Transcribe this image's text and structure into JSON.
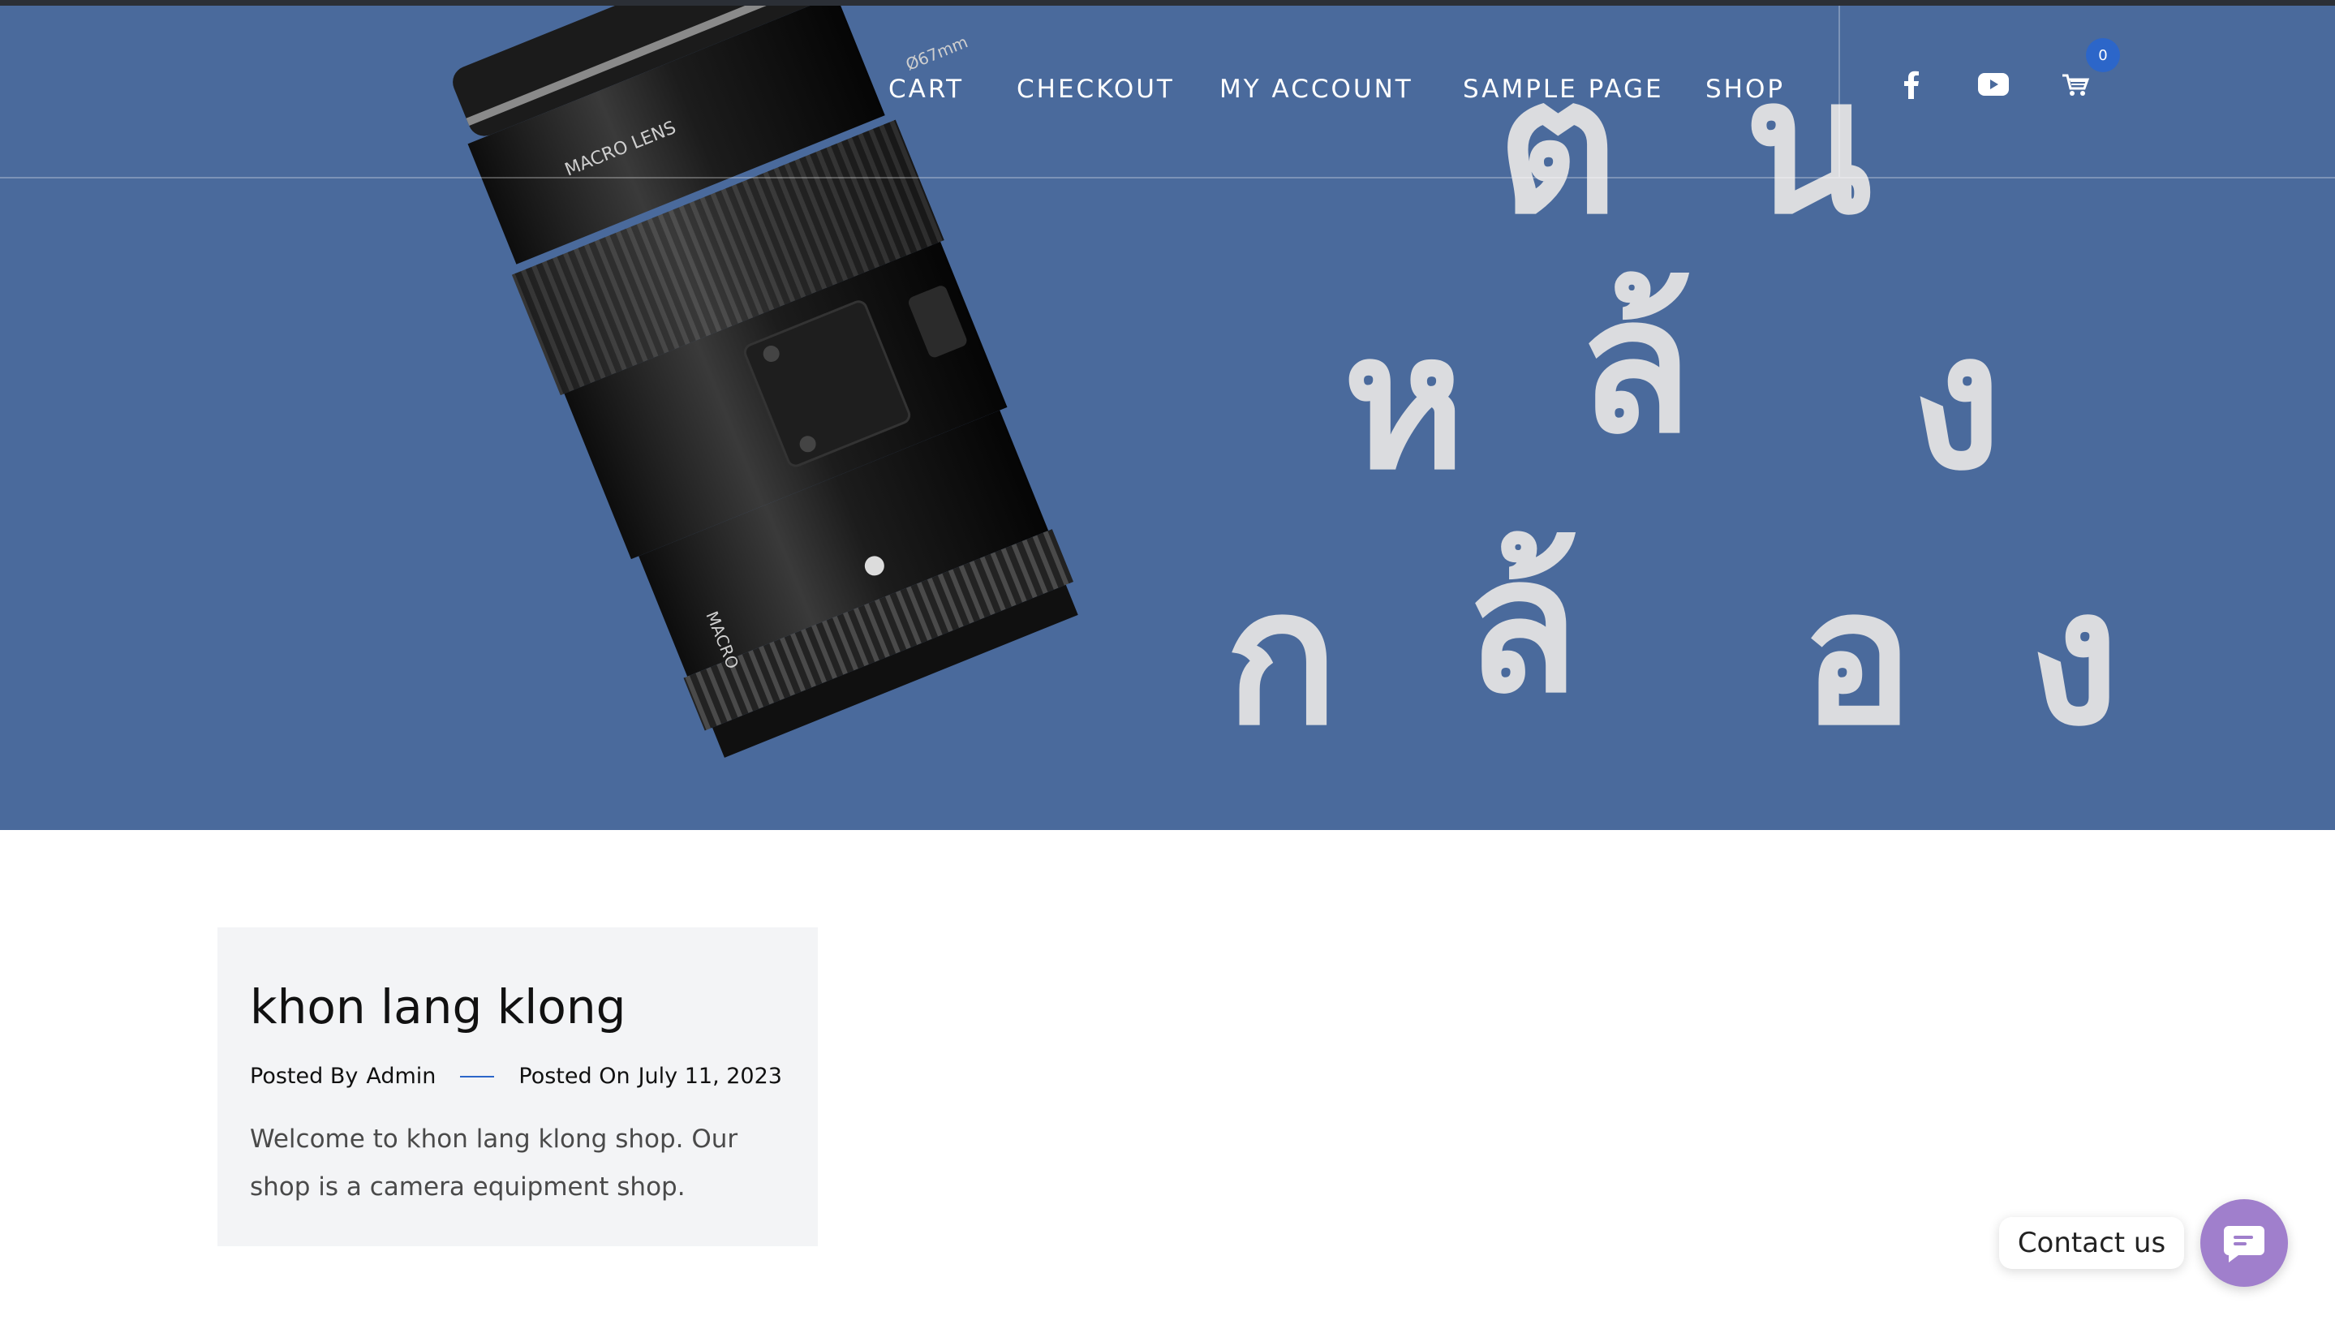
{
  "nav": {
    "items": [
      {
        "label": "CART"
      },
      {
        "label": "CHECKOUT"
      },
      {
        "label": "MY ACCOUNT"
      },
      {
        "label": "SAMPLE PAGE"
      },
      {
        "label": "SHOP"
      }
    ],
    "social": [
      "facebook-icon",
      "youtube-icon"
    ],
    "cart_count": "0"
  },
  "hero": {
    "lens_text_1": "MACRO LENS",
    "lens_text_2": "MACRO",
    "lens_text_3": "Ø67mm",
    "thai_row1": [
      "ต",
      "น"
    ],
    "thai_row2": [
      "ห",
      "ล้",
      "ง"
    ],
    "thai_row3": [
      "ก",
      "ล้",
      "อ",
      "ง"
    ],
    "colors": {
      "background": "#4a6a9c",
      "letters": "#e3e3e3"
    }
  },
  "post": {
    "title": "khon lang klong",
    "posted_by_label": "Posted By",
    "author": "Admin",
    "posted_on_label": "Posted On",
    "date": "July 11, 2023",
    "excerpt": "Welcome to khon lang klong shop. Our shop is a camera equipment shop."
  },
  "contact": {
    "label": "Contact us"
  }
}
